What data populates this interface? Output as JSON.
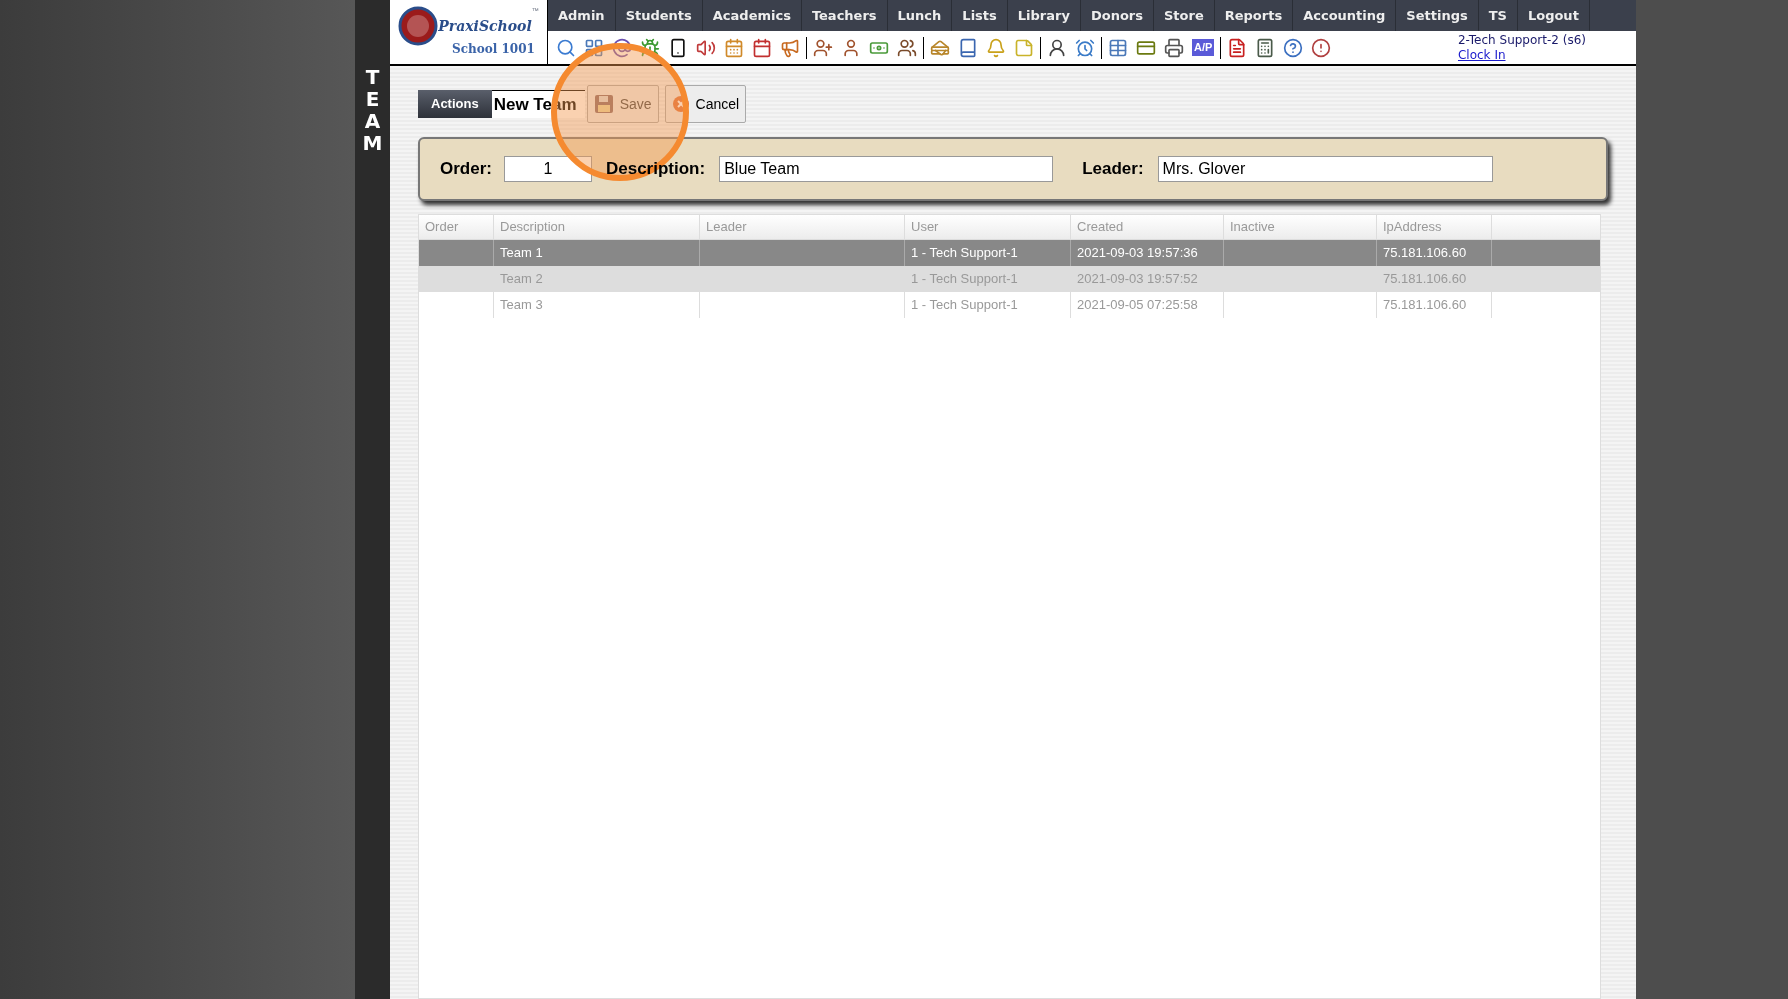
{
  "side_title": "TEAM",
  "logo": {
    "brand": "PraxiSchool",
    "trademark": "™",
    "school": "School 1001"
  },
  "nav": [
    "Admin",
    "Students",
    "Academics",
    "Teachers",
    "Lunch",
    "Lists",
    "Library",
    "Donors",
    "Store",
    "Reports",
    "Accounting",
    "Settings",
    "TS",
    "Logout"
  ],
  "toolbar": {
    "ap_label": "A/P"
  },
  "user": {
    "name": "2-Tech Support-2 (s6)",
    "link": "Clock In"
  },
  "actions": {
    "tab": "Actions",
    "title": "New Team",
    "save": "Save",
    "cancel": "Cancel"
  },
  "form": {
    "order_label": "Order:",
    "order_value": "1",
    "description_label": "Description:",
    "description_value": "Blue Team",
    "leader_label": "Leader:",
    "leader_value": "Mrs. Glover"
  },
  "table": {
    "columns": [
      "Order",
      "Description",
      "Leader",
      "User",
      "Created",
      "Inactive",
      "IpAddress"
    ],
    "rows": [
      {
        "selected": true,
        "hovered": false,
        "cells": [
          "",
          "Team 1",
          "",
          "1 - Tech Support-1",
          "2021-09-03 19:57:36",
          "",
          "75.181.106.60"
        ]
      },
      {
        "selected": false,
        "hovered": true,
        "cells": [
          "",
          "Team 2",
          "",
          "1 - Tech Support-1",
          "2021-09-03 19:57:52",
          "",
          "75.181.106.60"
        ]
      },
      {
        "selected": false,
        "hovered": false,
        "cells": [
          "",
          "Team 3",
          "",
          "1 - Tech Support-1",
          "2021-09-05 07:25:58",
          "",
          "75.181.106.60"
        ]
      }
    ]
  },
  "click_highlight": true
}
